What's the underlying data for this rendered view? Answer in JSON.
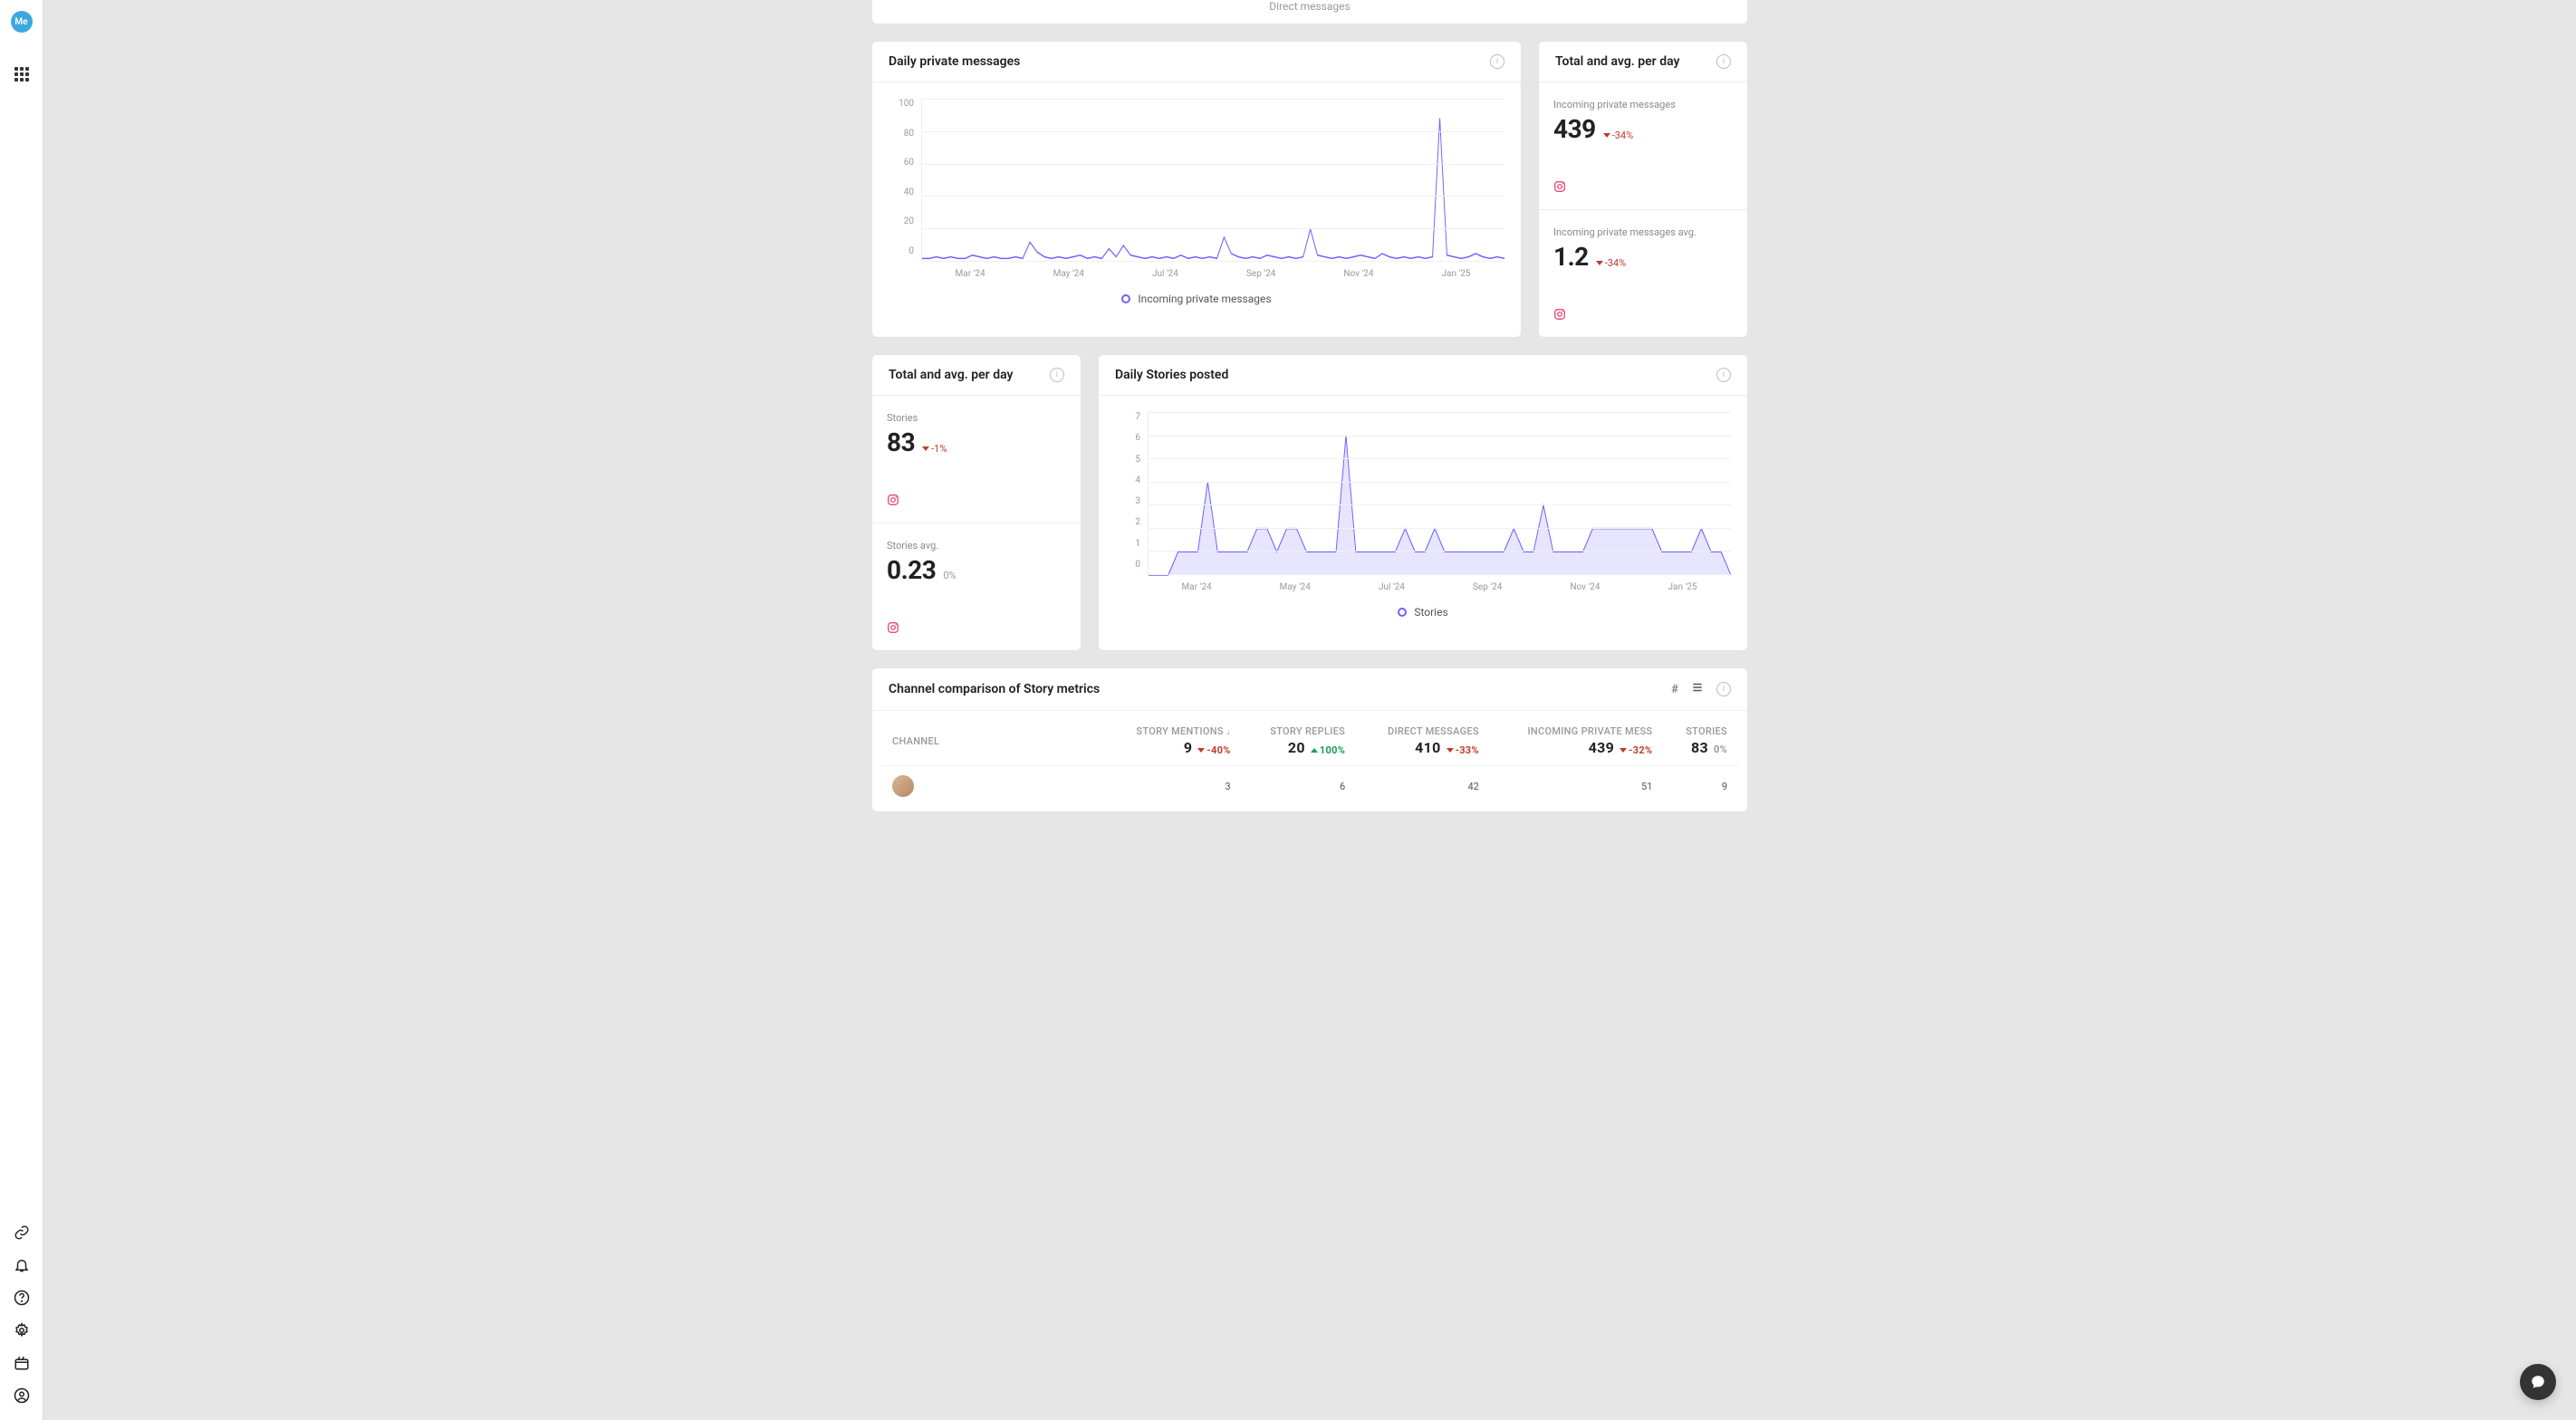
{
  "top_card_label": "Direct messages",
  "cards": {
    "dpm": {
      "title": "Daily private messages"
    },
    "tapd_right": {
      "title": "Total and avg. per day"
    },
    "tapd_left": {
      "title": "Total and avg. per day"
    },
    "dsp": {
      "title": "Daily Stories posted"
    },
    "comp": {
      "title": "Channel comparison of Story metrics"
    }
  },
  "metrics": {
    "inc_msg": {
      "label": "Incoming private messages",
      "value": "439",
      "delta": "-34%",
      "dir": "down"
    },
    "inc_msg_avg": {
      "label": "Incoming private messages avg.",
      "value": "1.2",
      "delta": "-34%",
      "dir": "down"
    },
    "stories": {
      "label": "Stories",
      "value": "83",
      "delta": "-1%",
      "dir": "down"
    },
    "stories_avg": {
      "label": "Stories avg.",
      "value": "0.23",
      "delta": "0%",
      "dir": "neutral"
    }
  },
  "chart_data": [
    {
      "id": "daily_private_messages",
      "type": "line",
      "title": "Daily private messages",
      "ylabel": "",
      "ylim": [
        0,
        100
      ],
      "yticks": [
        0,
        20,
        40,
        60,
        80,
        100
      ],
      "xticks": [
        "Mar '24",
        "May '24",
        "Jul '24",
        "Sep '24",
        "Nov '24",
        "Jan '25"
      ],
      "series": [
        {
          "name": "Incoming private messages",
          "x_range": [
            "2024-02",
            "2025-01"
          ],
          "values": [
            2,
            2,
            3,
            2,
            3,
            2,
            2,
            4,
            3,
            2,
            3,
            2,
            2,
            3,
            2,
            12,
            6,
            3,
            2,
            3,
            2,
            3,
            4,
            2,
            3,
            2,
            8,
            3,
            10,
            4,
            3,
            2,
            3,
            2,
            3,
            2,
            4,
            2,
            3,
            2,
            3,
            2,
            15,
            5,
            3,
            2,
            3,
            2,
            4,
            3,
            2,
            3,
            2,
            3,
            20,
            4,
            3,
            2,
            3,
            2,
            3,
            4,
            3,
            2,
            5,
            3,
            2,
            3,
            2,
            3,
            2,
            3,
            88,
            4,
            3,
            2,
            3,
            5,
            3,
            2,
            3,
            2
          ]
        }
      ]
    },
    {
      "id": "daily_stories_posted",
      "type": "area",
      "title": "Daily Stories posted",
      "ylabel": "",
      "ylim": [
        0,
        7
      ],
      "yticks": [
        0,
        1,
        2,
        3,
        4,
        5,
        6,
        7
      ],
      "xticks": [
        "Mar '24",
        "May '24",
        "Jul '24",
        "Sep '24",
        "Nov '24",
        "Jan '25"
      ],
      "series": [
        {
          "name": "Stories",
          "x_range": [
            "2024-02",
            "2025-01"
          ],
          "values": [
            0,
            0,
            0,
            1,
            1,
            1,
            4,
            1,
            1,
            1,
            1,
            2,
            2,
            1,
            2,
            2,
            1,
            1,
            1,
            1,
            6,
            1,
            1,
            1,
            1,
            1,
            2,
            1,
            1,
            2,
            1,
            1,
            1,
            1,
            1,
            1,
            1,
            2,
            1,
            1,
            3,
            1,
            1,
            1,
            1,
            2,
            2,
            2,
            2,
            2,
            2,
            2,
            1,
            1,
            1,
            1,
            2,
            1,
            1,
            0
          ]
        }
      ]
    }
  ],
  "legend": {
    "dpm": "Incoming private messages",
    "dsp": "Stories"
  },
  "table": {
    "columns": {
      "channel": "CHANNEL",
      "mentions": "STORY MENTIONS",
      "replies": "STORY REPLIES",
      "dm": "DIRECT MESSAGES",
      "inc": "INCOMING PRIVATE MESS",
      "stories": "STORIES"
    },
    "totals": {
      "mentions": {
        "value": "9",
        "delta": "-40%",
        "dir": "down"
      },
      "replies": {
        "value": "20",
        "delta": "100%",
        "dir": "up"
      },
      "dm": {
        "value": "410",
        "delta": "-33%",
        "dir": "down"
      },
      "inc": {
        "value": "439",
        "delta": "-32%",
        "dir": "down"
      },
      "stories": {
        "value": "83",
        "delta": "0%",
        "dir": "neutral"
      }
    },
    "rows": [
      {
        "channel": "",
        "mentions": "3",
        "replies": "6",
        "dm": "42",
        "inc": "51",
        "stories": "9"
      }
    ]
  }
}
